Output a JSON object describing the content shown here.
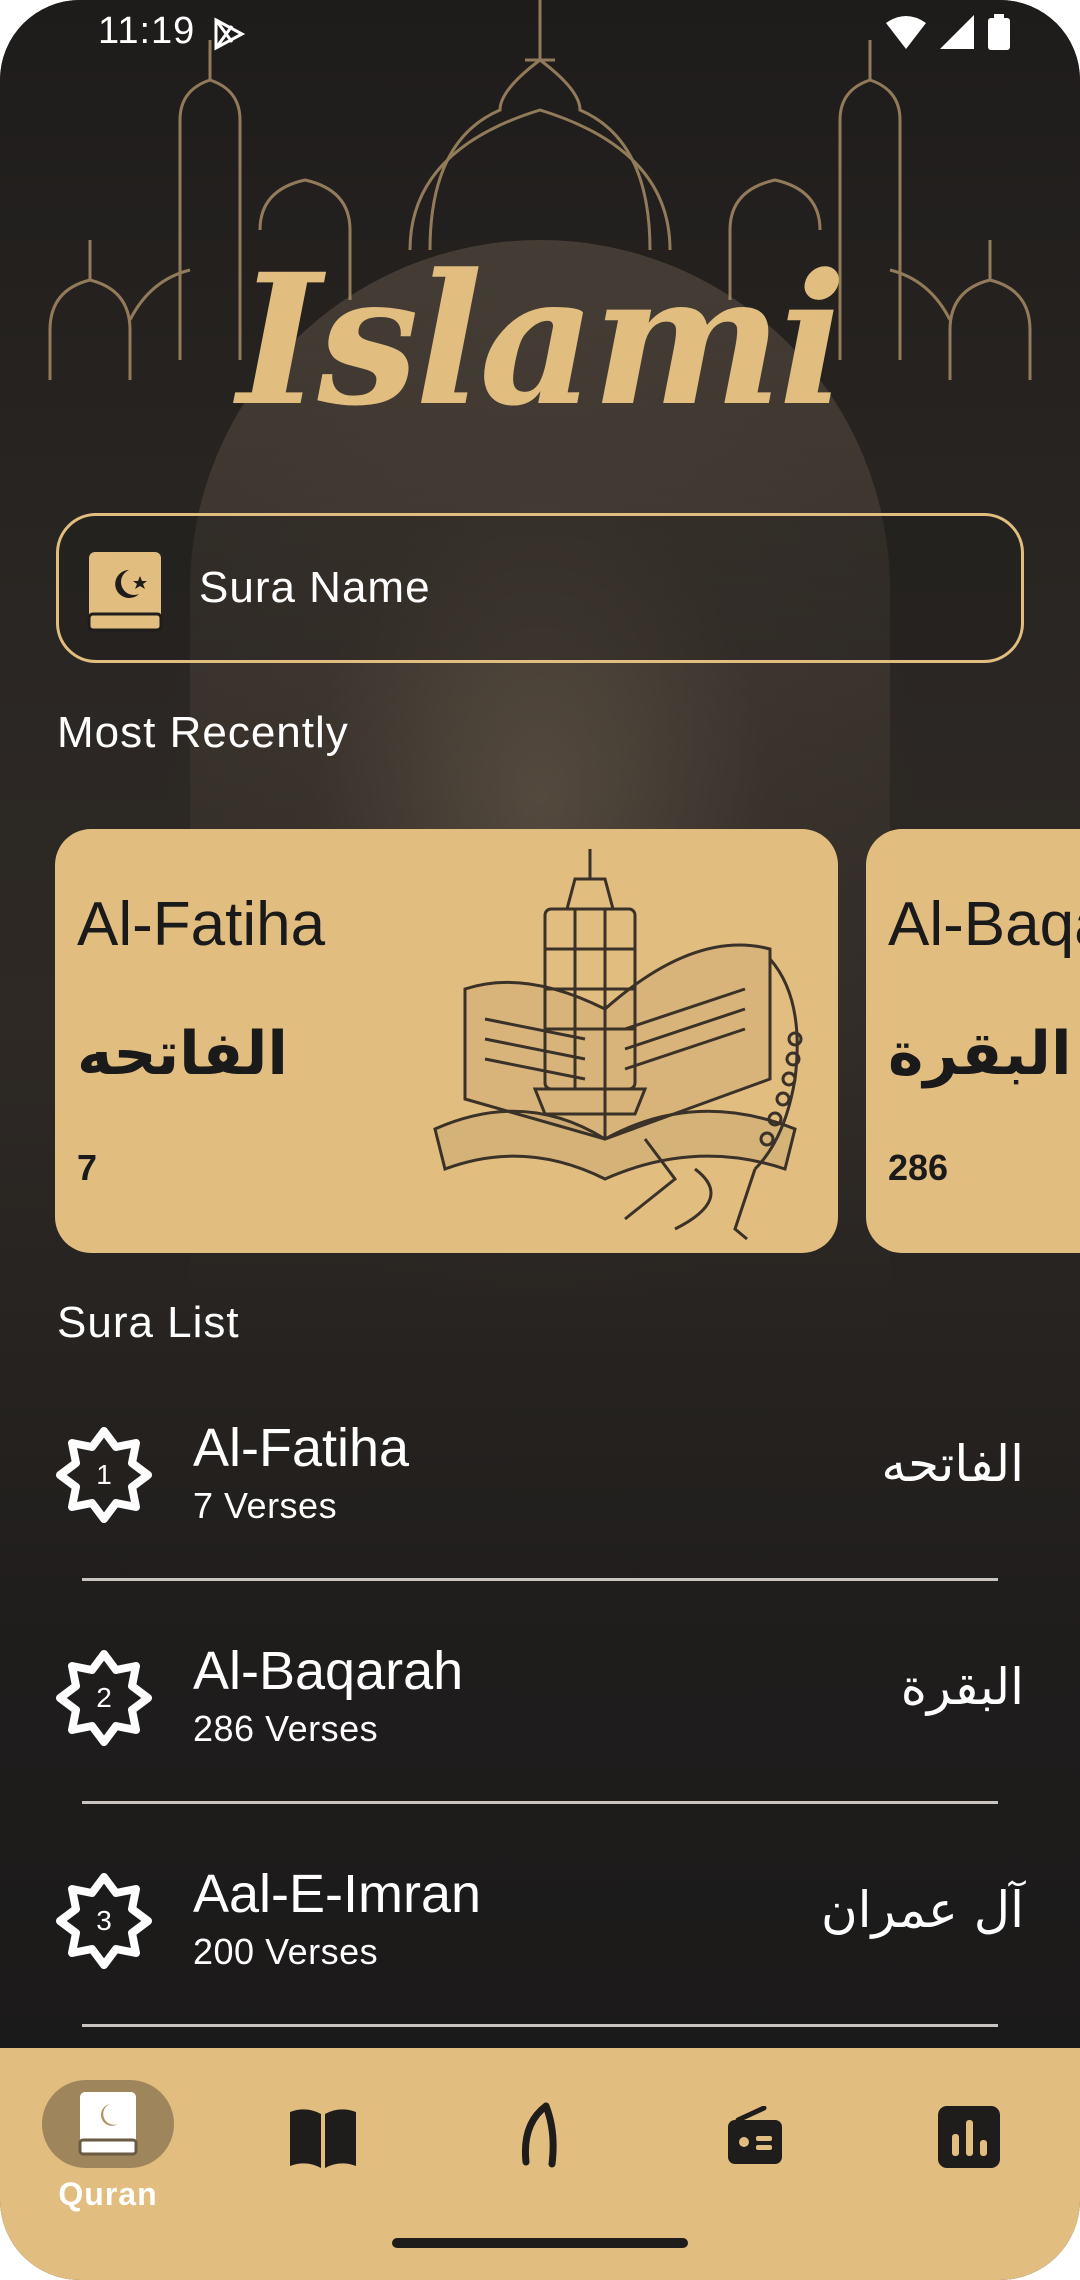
{
  "status_bar": {
    "time": "11:19"
  },
  "app": {
    "logo_text": "Islami"
  },
  "search": {
    "placeholder": "Sura Name"
  },
  "sections": {
    "recent_title": "Most Recently",
    "list_title": "Sura List"
  },
  "recent": [
    {
      "name_en": "Al-Fatiha",
      "name_ar": "الفاتحه",
      "verses": "7"
    },
    {
      "name_en": "Al-Baqarah",
      "name_ar": "البقرة",
      "verses": "286"
    }
  ],
  "suras": [
    {
      "number": "1",
      "name_en": "Al-Fatiha",
      "verses": "7 Verses",
      "name_ar": "الفاتحه"
    },
    {
      "number": "2",
      "name_en": "Al-Baqarah",
      "verses": "286 Verses",
      "name_ar": "البقرة"
    },
    {
      "number": "3",
      "name_en": "Aal-E-Imran",
      "verses": "200 Verses",
      "name_ar": "آل عمران"
    }
  ],
  "nav": [
    {
      "label": "Quran",
      "icon": "quran-icon",
      "active": true
    },
    {
      "label": "",
      "icon": "hadith-book-icon"
    },
    {
      "label": "",
      "icon": "sebha-icon"
    },
    {
      "label": "",
      "icon": "radio-icon"
    },
    {
      "label": "",
      "icon": "time-chart-icon"
    }
  ],
  "colors": {
    "accent": "#E2BD80",
    "background": "#1F1D1C",
    "text": "#FFFFFF"
  }
}
